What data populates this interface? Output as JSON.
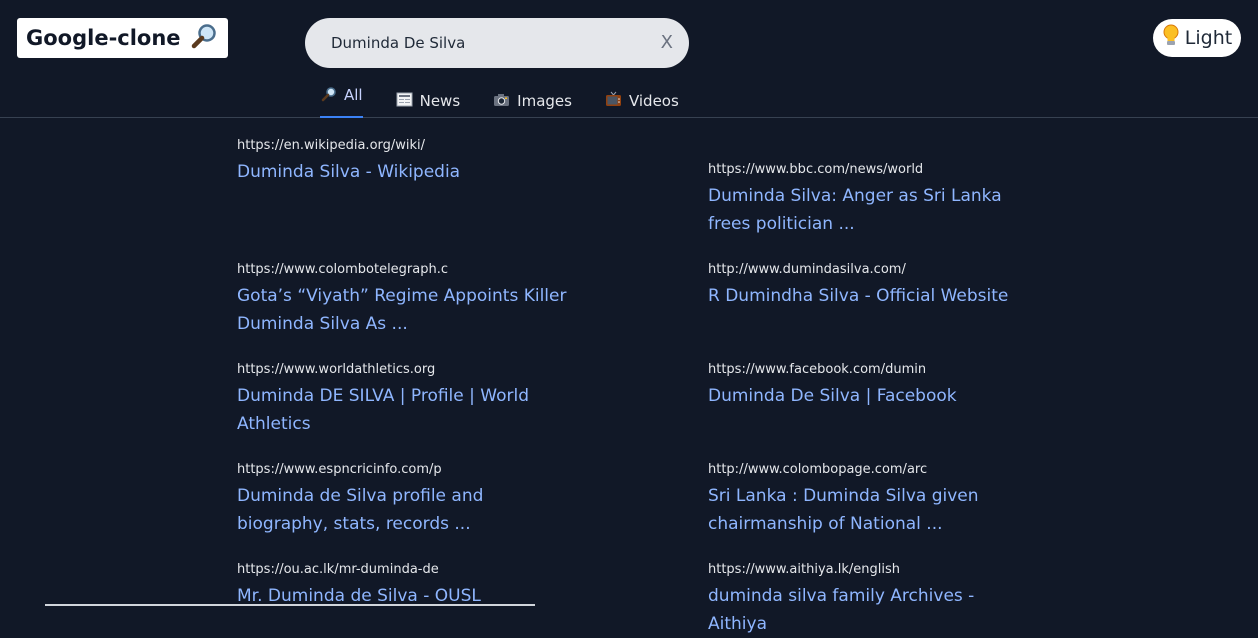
{
  "header": {
    "logo_text": "Google-clone",
    "logo_icon": "magnifier-icon",
    "search": {
      "value": "Duminda De Silva",
      "placeholder": "",
      "clear_label": "X"
    },
    "theme_toggle": {
      "label": "Light",
      "icon": "lightbulb-icon"
    },
    "tabs": [
      {
        "label": "All",
        "icon": "magnifier-icon"
      },
      {
        "label": "News",
        "icon": "newspaper-icon"
      },
      {
        "label": "Images",
        "icon": "camera-icon"
      },
      {
        "label": "Videos",
        "icon": "tv-icon"
      }
    ]
  },
  "results": [
    {
      "url": "https://en.wikipedia.org/wiki/",
      "title": "Duminda Silva - Wikipedia"
    },
    {
      "url": "https://www.bbc.com/news/world",
      "title": "Duminda Silva: Anger as Sri Lanka frees politician ..."
    },
    {
      "url": "https://www.colombotelegraph.c",
      "title": "Gota’s “Viyath” Regime Appoints Killer Duminda Silva As ..."
    },
    {
      "url": "http://www.dumindasilva.com/",
      "title": "R Dumindha Silva - Official Website"
    },
    {
      "url": "https://www.worldathletics.org",
      "title": "Duminda DE SILVA | Profile | World Athletics"
    },
    {
      "url": "https://www.facebook.com/dumin",
      "title": "Duminda De Silva | Facebook"
    },
    {
      "url": "https://www.espncricinfo.com/p",
      "title": "Duminda de Silva profile and biography, stats, records ..."
    },
    {
      "url": "http://www.colombopage.com/arc",
      "title": "Sri Lanka : Duminda Silva given chairmanship of National ..."
    },
    {
      "url": "https://ou.ac.lk/mr-duminda-de",
      "title": "Mr. Duminda de Silva - OUSL"
    },
    {
      "url": "https://www.aithiya.lk/english",
      "title": "duminda silva family Archives - Aithiya"
    }
  ],
  "colors": {
    "background": "#111827",
    "link": "#8fb6ff",
    "active_tab_underline": "#3b82f6"
  }
}
